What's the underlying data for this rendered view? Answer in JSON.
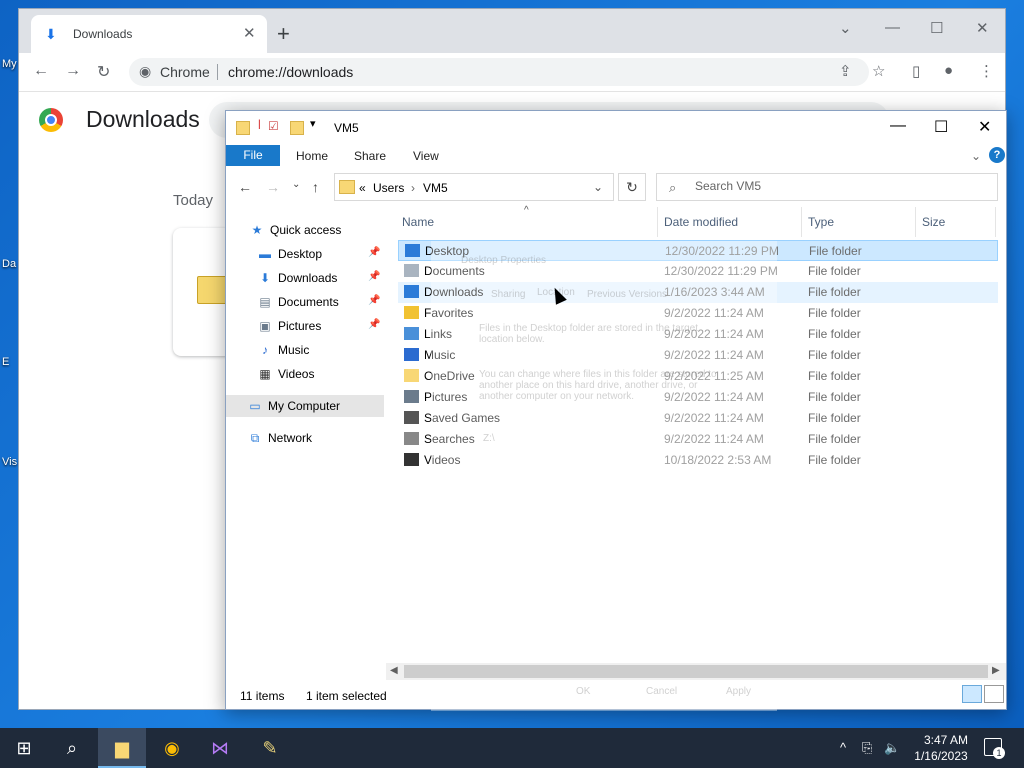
{
  "desktop": {
    "fragments": [
      "My",
      "Da",
      "E",
      "Vis"
    ]
  },
  "chrome": {
    "tab_title": "Downloads",
    "new_tab_symbol": "+",
    "omnibox_label": "Chrome",
    "url": "chrome://downloads",
    "page_title": "Downloads",
    "section_today": "Today"
  },
  "explorer": {
    "title": "VM5",
    "ribbon": {
      "file": "File",
      "tabs": [
        "Home",
        "Share",
        "View"
      ]
    },
    "address": {
      "more": "«",
      "segments": [
        "Users",
        "VM5"
      ]
    },
    "search_placeholder": "Search VM5",
    "nav": [
      {
        "label": "Quick access",
        "icon": "star-icon",
        "pinned": false
      },
      {
        "label": "Desktop",
        "icon": "desktop-icon",
        "pinned": true
      },
      {
        "label": "Downloads",
        "icon": "download-arrow-icon",
        "pinned": true
      },
      {
        "label": "Documents",
        "icon": "documents-icon",
        "pinned": true
      },
      {
        "label": "Pictures",
        "icon": "pictures-icon",
        "pinned": true
      },
      {
        "label": "Music",
        "icon": "music-note-icon",
        "pinned": false
      },
      {
        "label": "Videos",
        "icon": "film-icon",
        "pinned": false
      },
      {
        "label": "My Computer",
        "icon": "computer-icon",
        "pinned": false,
        "selected": true
      },
      {
        "label": "Network",
        "icon": "network-icon",
        "pinned": false
      }
    ],
    "columns": [
      "Name",
      "Date modified",
      "Type",
      "Size"
    ],
    "rows": [
      {
        "name": "Desktop",
        "date": "12/30/2022 11:29 PM",
        "type": "File folder",
        "icon": "desktop-icon",
        "state": "selected"
      },
      {
        "name": "Documents",
        "date": "12/30/2022 11:29 PM",
        "type": "File folder",
        "icon": "documents-icon"
      },
      {
        "name": "Downloads",
        "date": "1/16/2023 3:44 AM",
        "type": "File folder",
        "icon": "download-arrow-icon",
        "state": "hover"
      },
      {
        "name": "Favorites",
        "date": "9/2/2022 11:24 AM",
        "type": "File folder",
        "icon": "star-icon"
      },
      {
        "name": "Links",
        "date": "9/2/2022 11:24 AM",
        "type": "File folder",
        "icon": "link-icon"
      },
      {
        "name": "Music",
        "date": "9/2/2022 11:24 AM",
        "type": "File folder",
        "icon": "music-note-icon"
      },
      {
        "name": "OneDrive",
        "date": "9/2/2022 11:25 AM",
        "type": "File folder",
        "icon": "folder-icon"
      },
      {
        "name": "Pictures",
        "date": "9/2/2022 11:24 AM",
        "type": "File folder",
        "icon": "pictures-icon"
      },
      {
        "name": "Saved Games",
        "date": "9/2/2022 11:24 AM",
        "type": "File folder",
        "icon": "saved-games-icon"
      },
      {
        "name": "Searches",
        "date": "9/2/2022 11:24 AM",
        "type": "File folder",
        "icon": "search-icon"
      },
      {
        "name": "Videos",
        "date": "10/18/2022 2:53 AM",
        "type": "File folder",
        "icon": "film-icon"
      }
    ],
    "status_items": "11 items",
    "status_selected": "1 item selected"
  },
  "ghost_dialog": {
    "title": "Desktop Properties",
    "tabs": [
      "Sharing",
      "Location",
      "Previous Versions"
    ],
    "text1": "Files in the Desktop folder are stored in the target location below.",
    "text2": "You can change where files in this folder are stored to another place on this hard drive, another drive, or another computer on your network.",
    "path_value": "Z:\\",
    "buttons": [
      "OK",
      "Cancel",
      "Apply"
    ]
  },
  "taskbar": {
    "time": "3:47 AM",
    "date": "1/16/2023",
    "notification_count": "1",
    "accent": "#76b9ed"
  }
}
